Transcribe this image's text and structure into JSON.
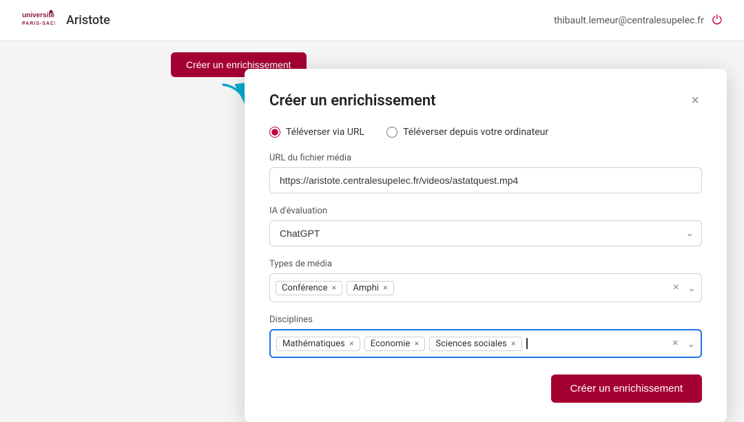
{
  "header": {
    "university_line1": "université",
    "university_line2": "PARIS-SACLAY",
    "app_name": "Aristote",
    "user_email": "thibault.lemeur@centralesupelec.fr"
  },
  "top_button": {
    "label": "Créer un enrichissement"
  },
  "modal": {
    "title": "Créer un enrichissement",
    "close_label": "×",
    "radio_option1": "Téléverser via URL",
    "radio_option2": "Téléverser depuis votre ordinateur",
    "url_label": "URL du fichier média",
    "url_value": "https://aristote.centralesupelec.fr/videos/astatquest.mp4",
    "ia_label": "IA d'évaluation",
    "ia_value": "ChatGPT",
    "media_types_label": "Types de média",
    "media_tags": [
      "Conférence",
      "Amphi"
    ],
    "disciplines_label": "Disciplines",
    "discipline_tags": [
      "Mathématiques",
      "Economie",
      "Sciences sociales"
    ],
    "submit_label": "Créer un enrichissement"
  }
}
